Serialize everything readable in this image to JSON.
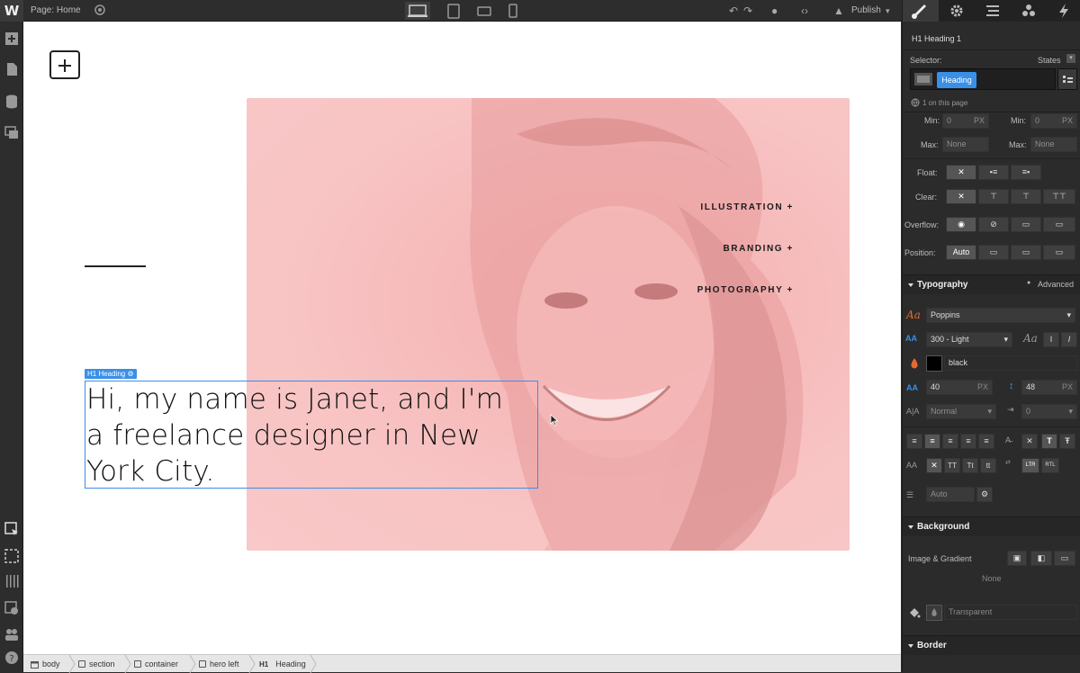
{
  "topbar": {
    "page_label": "Page: Home",
    "publish_label": "Publish"
  },
  "canvas": {
    "nav_links": [
      "ILLUSTRATION +",
      "BRANDING +",
      "PHOTOGRAPHY +"
    ],
    "heading_tag": "H1 Heading",
    "heading_lines": [
      "Hi, my name is Janet, and I'm",
      "a freelance designer in New",
      "York City."
    ]
  },
  "breadcrumb": [
    "body",
    "section",
    "container",
    "hero left",
    "Heading"
  ],
  "breadcrumb_h1_prefix": "H1",
  "panel": {
    "element_title": "H1 Heading 1",
    "selector_label": "Selector:",
    "states_label": "States",
    "selector_chip": "Heading",
    "on_page": "1 on this page",
    "min_label": "Min:",
    "max_label": "Max:",
    "min_value": "0",
    "min_unit": "PX",
    "max_value": "None",
    "float_label": "Float:",
    "clear_label": "Clear:",
    "overflow_label": "Overflow:",
    "position_label": "Position:",
    "position_value": "Auto",
    "typography_title": "Typography",
    "advanced_label": "Advanced",
    "font_family": "Poppins",
    "font_weight": "300 - Light",
    "color_name": "black",
    "font_size": "40",
    "font_size_unit": "PX",
    "line_height": "48",
    "line_height_unit": "PX",
    "letter_spacing": "Normal",
    "indent": "0",
    "columns": "Auto",
    "background_title": "Background",
    "image_gradient_label": "Image & Gradient",
    "none_label": "None",
    "transparent_label": "Transparent",
    "border_title": "Border"
  },
  "colors": {
    "accent": "#3a8fe8",
    "hero_pink": "#f8c3c3"
  }
}
